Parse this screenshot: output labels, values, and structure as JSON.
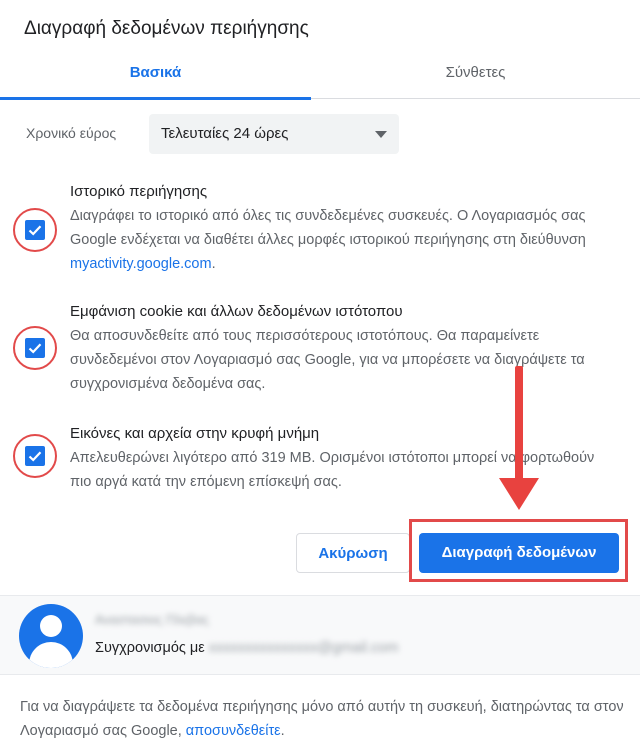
{
  "dialog": {
    "title": "Διαγραφή δεδομένων περιήγησης",
    "tabs": [
      {
        "label": "Βασικά"
      },
      {
        "label": "Σύνθετες"
      }
    ]
  },
  "time_range": {
    "label": "Χρονικό εύρος",
    "value": "Τελευταίες 24 ώρες"
  },
  "options": [
    {
      "title": "Ιστορικό περιήγησης",
      "description": "Διαγράφει το ιστορικό από όλες τις συνδεδεμένες συσκευές. Ο Λογαριασμός σας Google ενδέχεται να διαθέτει άλλες μορφές ιστορικού περιήγησης στη διεύθυνση ",
      "link": "myactivity.google.com",
      "link_suffix": ".",
      "checked": true
    },
    {
      "title": "Εμφάνιση cookie και άλλων δεδομένων ιστότοπου",
      "description": "Θα αποσυνδεθείτε από τους περισσότερους ιστοτόπους. Θα παραμείνετε συνδεδεμένοι στον Λογαριασμό σας Google, για να μπορέσετε να διαγράψετε τα συγχρονισμένα δεδομένα σας.",
      "checked": true
    },
    {
      "title": "Εικόνες και αρχεία στην κρυφή μνήμη",
      "description": "Απελευθερώνει λιγότερο από 319 MB. Ορισμένοι ιστότοποι μπορεί να φορτωθούν πιο αργά κατά την επόμενη επίσκεψή σας.",
      "checked": true
    }
  ],
  "buttons": {
    "cancel": "Ακύρωση",
    "delete": "Διαγραφή δεδομένων"
  },
  "account": {
    "name": "Αναστασιος Πλεβας",
    "sync_prefix": "Συγχρονισμός με ",
    "email": "xxxxxxxxxxxxxxx@gmail.com"
  },
  "footer": {
    "text": "Για να διαγράψετε τα δεδομένα περιήγησης μόνο από αυτήν τη συσκευή, διατηρώντας τα στον Λογαριασμό σας Google, ",
    "link": "αποσυνδεθείτε",
    "suffix": "."
  },
  "colors": {
    "accent": "#1a73e8",
    "annotation": "#e24a4a"
  }
}
